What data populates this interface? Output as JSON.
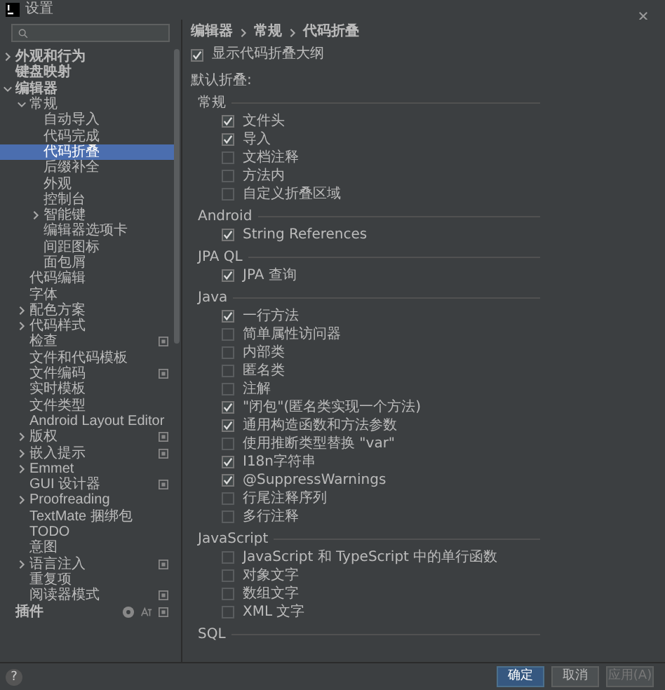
{
  "window": {
    "title": "设置"
  },
  "sidebar": {
    "items": [
      {
        "label": "外观和行为",
        "expanded": false
      },
      {
        "label": "键盘映射"
      },
      {
        "label": "编辑器",
        "expanded": true,
        "children": [
          {
            "label": "常规",
            "expanded": true,
            "children": [
              {
                "label": "自动导入",
                "selected": false
              },
              {
                "label": "代码完成",
                "selected": false
              },
              {
                "label": "代码折叠",
                "selected": true
              },
              {
                "label": "后缀补全",
                "selected": false
              },
              {
                "label": "外观",
                "selected": false
              },
              {
                "label": "控制台",
                "selected": false
              },
              {
                "label": "智能键",
                "expanded": false,
                "selected": false
              },
              {
                "label": "编辑器选项卡",
                "selected": false
              },
              {
                "label": "间距图标",
                "selected": false
              },
              {
                "label": "面包屑",
                "selected": false
              }
            ]
          },
          {
            "label": "代码编辑"
          },
          {
            "label": "字体"
          },
          {
            "label": "配色方案",
            "expanded": false
          },
          {
            "label": "代码样式",
            "expanded": false
          },
          {
            "label": "检查",
            "scoped": true
          },
          {
            "label": "文件和代码模板"
          },
          {
            "label": "文件编码",
            "scoped": true
          },
          {
            "label": "实时模板"
          },
          {
            "label": "文件类型"
          },
          {
            "label": "Android Layout Editor"
          },
          {
            "label": "版权",
            "expanded": false,
            "scoped": true
          },
          {
            "label": "嵌入提示",
            "expanded": false,
            "scoped": true
          },
          {
            "label": "Emmet",
            "expanded": false
          },
          {
            "label": "GUI 设计器",
            "scoped": true
          },
          {
            "label": "Proofreading",
            "expanded": false
          },
          {
            "label": "TextMate 捆绑包"
          },
          {
            "label": "TODO"
          },
          {
            "label": "意图"
          },
          {
            "label": "语言注入",
            "expanded": false,
            "scoped": true
          },
          {
            "label": "重复项"
          },
          {
            "label": "阅读器模式",
            "scoped": true
          }
        ]
      },
      {
        "label": "插件",
        "scoped": true,
        "extras": true
      }
    ]
  },
  "breadcrumbs": [
    "编辑器",
    "常规",
    "代码折叠"
  ],
  "show_outline": {
    "label": "显示代码折叠大纲",
    "checked": true
  },
  "default_label": "默认折叠:",
  "groups": [
    {
      "title": "常规",
      "items": [
        {
          "label": "文件头",
          "checked": true
        },
        {
          "label": "导入",
          "checked": true
        },
        {
          "label": "文档注释",
          "checked": false
        },
        {
          "label": "方法内",
          "checked": false
        },
        {
          "label": "自定义折叠区域",
          "checked": false
        }
      ]
    },
    {
      "title": "Android",
      "items": [
        {
          "label": "String References",
          "checked": true
        }
      ]
    },
    {
      "title": "JPA QL",
      "items": [
        {
          "label": "JPA 查询",
          "checked": true
        }
      ]
    },
    {
      "title": "Java",
      "items": [
        {
          "label": "一行方法",
          "checked": true
        },
        {
          "label": "简单属性访问器",
          "checked": false
        },
        {
          "label": "内部类",
          "checked": false
        },
        {
          "label": "匿名类",
          "checked": false
        },
        {
          "label": "注解",
          "checked": false
        },
        {
          "label": "\"闭包\"(匿名类实现一个方法)",
          "checked": true
        },
        {
          "label": "通用构造函数和方法参数",
          "checked": true
        },
        {
          "label": "使用推断类型替换 \"var\"",
          "checked": false
        },
        {
          "label": "I18n字符串",
          "checked": true
        },
        {
          "label": "@SuppressWarnings",
          "checked": true
        },
        {
          "label": "行尾注释序列",
          "checked": false
        },
        {
          "label": "多行注释",
          "checked": false
        }
      ]
    },
    {
      "title": "JavaScript",
      "items": [
        {
          "label": "JavaScript 和 TypeScript 中的单行函数",
          "checked": false
        },
        {
          "label": "对象文字",
          "checked": false
        },
        {
          "label": "数组文字",
          "checked": false
        },
        {
          "label": "XML 文字",
          "checked": false
        }
      ]
    },
    {
      "title": "SQL"
    }
  ],
  "buttons": [
    {
      "label": "确定",
      "kind": "primary",
      "disabled": false
    },
    {
      "label": "取消",
      "kind": "default",
      "disabled": false
    },
    {
      "label": "应用(A)",
      "kind": "default",
      "disabled": true
    }
  ],
  "help": "?"
}
